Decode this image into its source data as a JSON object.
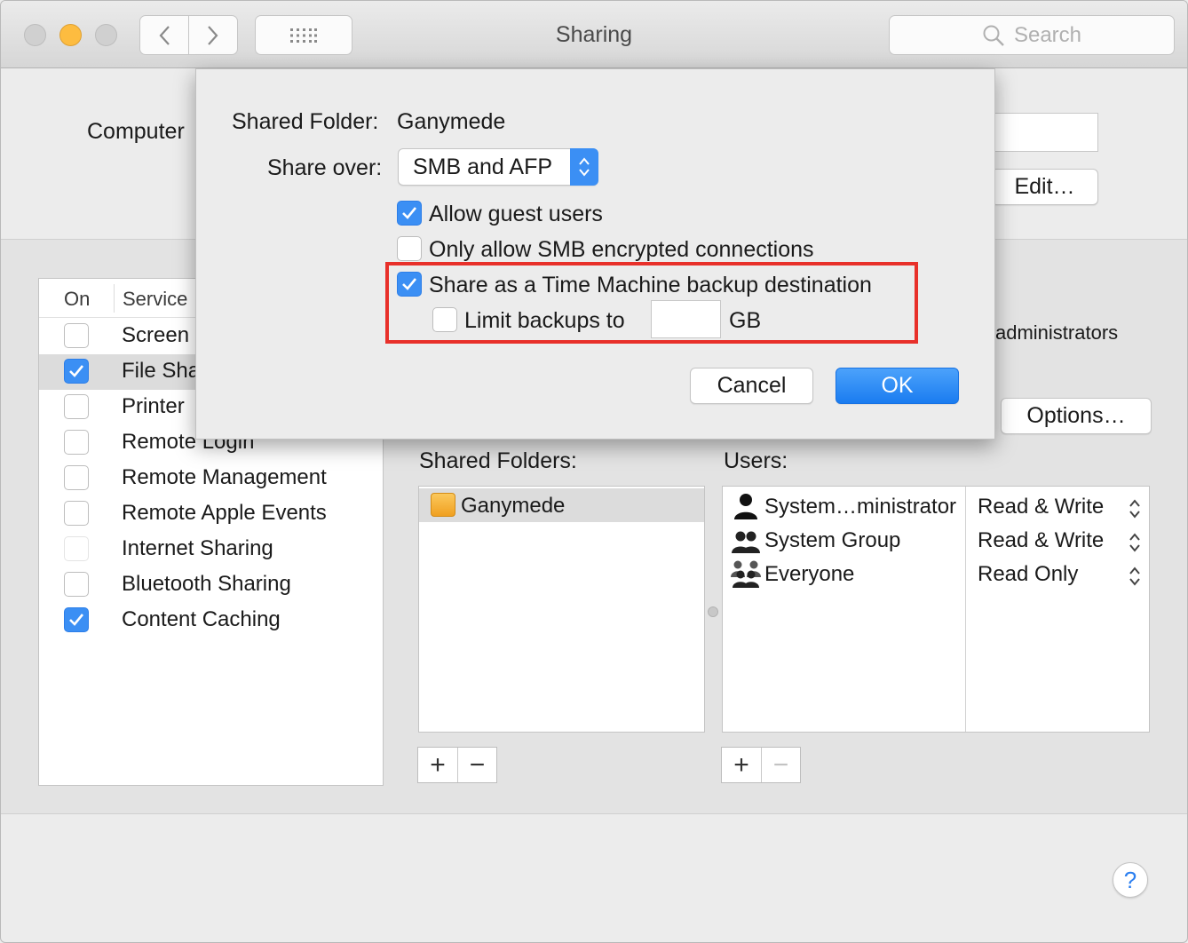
{
  "window": {
    "title": "Sharing"
  },
  "toolbar": {
    "search_placeholder": "Search"
  },
  "computer": {
    "label": "Computer",
    "edit_label": "Edit…"
  },
  "service_list": {
    "header_on": "On",
    "header_service": "Service",
    "items": [
      {
        "label": "Screen",
        "checked": false,
        "selected": false
      },
      {
        "label": "File Sha",
        "checked": true,
        "selected": true
      },
      {
        "label": "Printer",
        "checked": false,
        "selected": false
      },
      {
        "label": "Remote Login",
        "checked": false,
        "selected": false
      },
      {
        "label": "Remote Management",
        "checked": false,
        "selected": false
      },
      {
        "label": "Remote Apple Events",
        "checked": false,
        "selected": false
      },
      {
        "label": "Internet Sharing",
        "checked": false,
        "selected": false
      },
      {
        "label": "Bluetooth Sharing",
        "checked": false,
        "selected": false
      },
      {
        "label": "Content Caching",
        "checked": true,
        "selected": false
      }
    ]
  },
  "access_note": "administrators",
  "options_label": "Options…",
  "shared_folders": {
    "title": "Shared Folders:",
    "items": [
      "Ganymede"
    ]
  },
  "users": {
    "title": "Users:",
    "items": [
      {
        "name": "System…ministrator",
        "permission": "Read & Write",
        "icon": "single-user-icon"
      },
      {
        "name": "System Group",
        "permission": "Read & Write",
        "icon": "group-icon"
      },
      {
        "name": "Everyone",
        "permission": "Read Only",
        "icon": "everyone-icon"
      }
    ]
  },
  "buttons": {
    "plus": "+",
    "minus": "−",
    "help": "?"
  },
  "sheet": {
    "shared_folder_label": "Shared Folder:",
    "shared_folder_name": "Ganymede",
    "share_over_label": "Share over:",
    "share_over_value": "SMB and AFP",
    "allow_guest": {
      "label": "Allow guest users",
      "checked": true
    },
    "smb_encrypted": {
      "label": "Only allow SMB encrypted connections",
      "checked": false
    },
    "time_machine": {
      "label": "Share as a Time Machine backup destination",
      "checked": true
    },
    "limit_backups": {
      "label": "Limit backups to",
      "checked": false,
      "value": "",
      "unit": "GB"
    },
    "cancel_label": "Cancel",
    "ok_label": "OK"
  },
  "colors": {
    "accent": "#3b8ff4",
    "highlight_border": "#e8302a",
    "minimize": "#fdbc40"
  }
}
